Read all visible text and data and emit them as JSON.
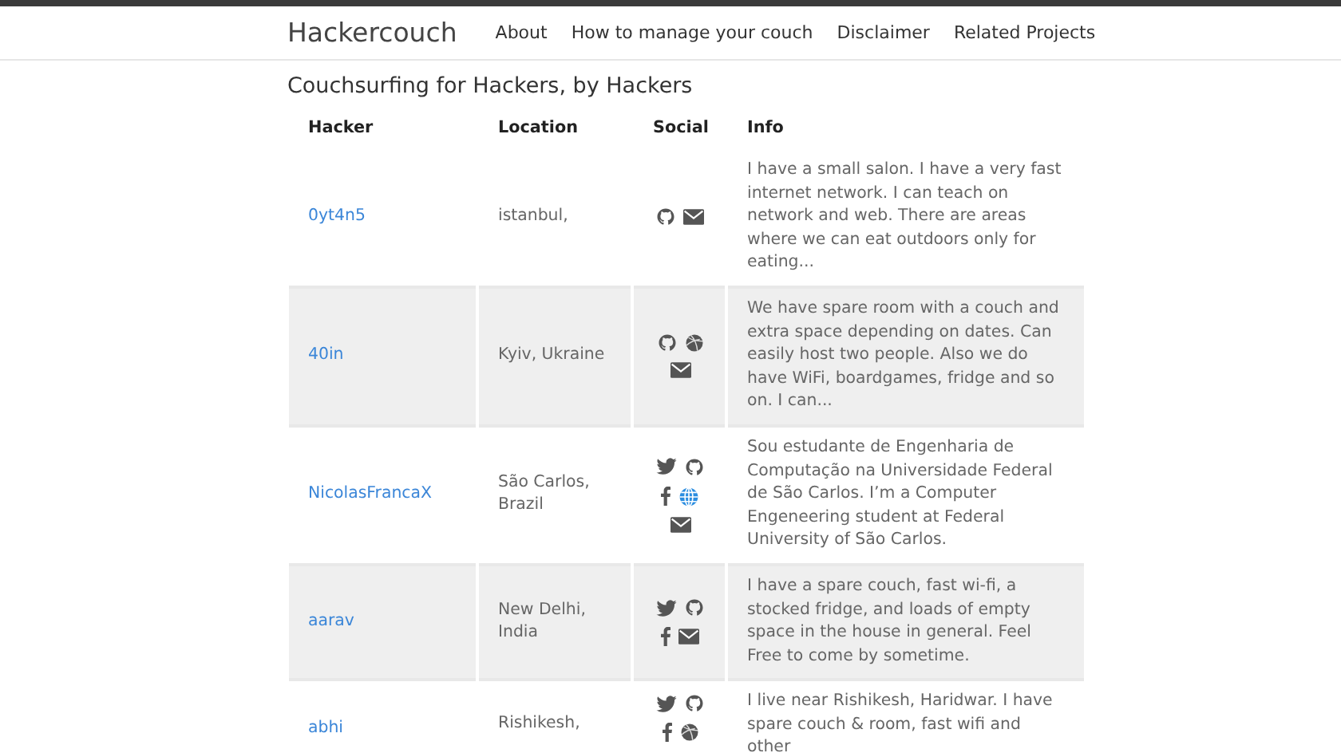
{
  "navbar": {
    "brand": "Hackercouch",
    "links": [
      "About",
      "How to manage your couch",
      "Disclaimer",
      "Related Projects"
    ]
  },
  "heading": "Couchsurfing for Hackers, by Hackers",
  "table": {
    "columns": [
      "Hacker",
      "Location",
      "Social",
      "Info"
    ],
    "rows": [
      {
        "hacker": "0yt4n5",
        "location": "istanbul,",
        "social": [
          {
            "kind": "github"
          },
          {
            "kind": "mail"
          }
        ],
        "info": "I have a small salon. I have a very fast internet network. I can teach on network and web. There are areas where we can eat outdoors only for eating..."
      },
      {
        "hacker": "40in",
        "location": "Kyiv, Ukraine",
        "social": [
          {
            "kind": "github"
          },
          {
            "kind": "ball"
          },
          {
            "kind": "mail"
          }
        ],
        "info": "We have spare room with a couch and extra space depending on dates. Can easily host two people. Also we do have WiFi, boardgames, fridge and so on. I can..."
      },
      {
        "hacker": "NicolasFrancaX",
        "location": "São Carlos, Brazil",
        "social": [
          {
            "kind": "twitter"
          },
          {
            "kind": "github"
          },
          {
            "kind": "facebook"
          },
          {
            "kind": "globe"
          },
          {
            "kind": "mail"
          }
        ],
        "info": "Sou estudante de Engenharia de Computação na Universidade Federal de São Carlos. I’m a Computer Engeneering student at Federal University of São Carlos."
      },
      {
        "hacker": "aarav",
        "location": "New Delhi, India",
        "social": [
          {
            "kind": "twitter"
          },
          {
            "kind": "github"
          },
          {
            "kind": "facebook"
          },
          {
            "kind": "mail"
          }
        ],
        "info": "I have a spare couch, fast wi-fi, a stocked fridge, and loads of empty space in the house in general. Feel Free to come by sometime."
      },
      {
        "hacker": "abhi",
        "location": "Rishikesh,",
        "social": [
          {
            "kind": "twitter"
          },
          {
            "kind": "github"
          },
          {
            "kind": "facebook"
          },
          {
            "kind": "ball"
          }
        ],
        "info": "I live near Rishikesh, Haridwar. I have spare couch & room, fast wifi and other"
      }
    ]
  }
}
